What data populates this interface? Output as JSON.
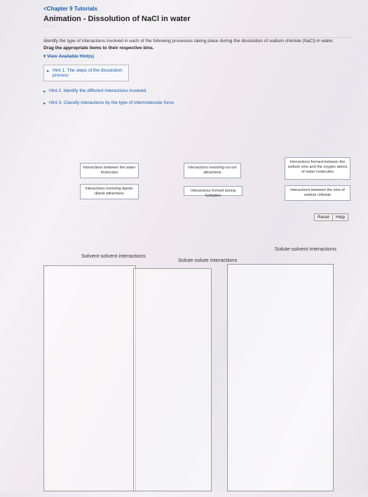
{
  "breadcrumb": "<Chapter 9 Tutorials",
  "title": "Animation - Dissolution of NaCl in water",
  "subtitle": "· · · · ·",
  "instructions": "Identify the type of interactions involved in each of the following processes taking place during the dissolution of sodium chloride (NaCl) in water.",
  "drag_text": "Drag the appropriate items to their respective bins.",
  "hints_toggle": "▾ View Available Hint(s)",
  "hints": [
    "Hint 1. The steps of the dissolution process",
    "Hint 2. Identify the different interactions involved",
    "Hint 3. Classify interactions by the type of intermolecular force"
  ],
  "tiles": [
    "Interactions between the water molecules",
    "Interactions involving ion-ion attractions",
    "Interactions formed between the sodium ions and the oxygen atoms of water molecules",
    "Interactions involving dipole-dipole attractions",
    "Interactions formed during hydration",
    "Interactions between the ions of sodium chloride"
  ],
  "buttons": {
    "reset": "Reset",
    "help": "Help"
  },
  "bins": [
    "Solvent-solvent interactions",
    "Solute-solute interactions",
    "Solute-solvent interactions"
  ]
}
